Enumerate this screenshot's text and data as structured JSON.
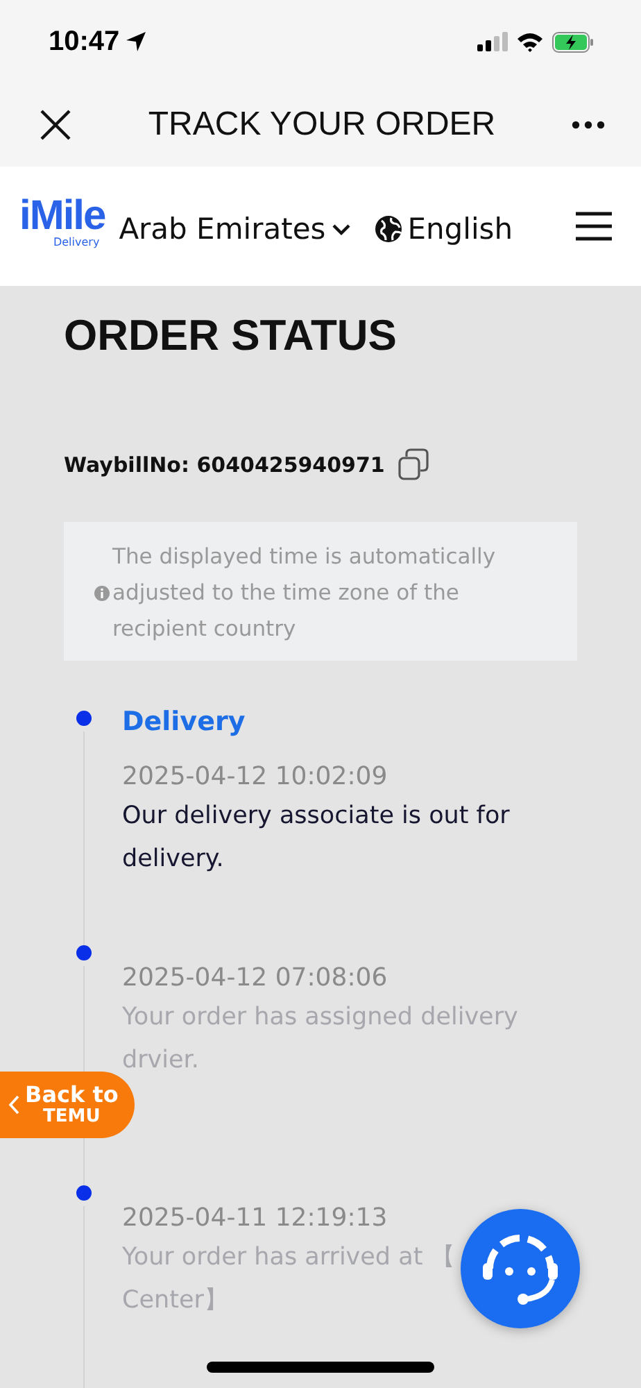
{
  "status_bar": {
    "time": "10:47"
  },
  "nav_bar": {
    "title": "TRACK YOUR ORDER"
  },
  "header": {
    "logo": {
      "name": "iMile",
      "tagline": "Delivery"
    },
    "country": "Arab Emirates",
    "language": "English"
  },
  "page": {
    "title": "ORDER STATUS",
    "waybill": "WaybillNo: 6040425940971",
    "notice": "The displayed time is automatically adjusted to the time zone of the recipient country"
  },
  "events": [
    {
      "title": "Delivery",
      "time": "2025-04-12 10:02:09",
      "lines": [
        "Our delivery associate is out for delivery."
      ],
      "current": true
    },
    {
      "time": "2025-04-12 07:08:06",
      "lines": [
        "Your order has assigned delivery drvier."
      ],
      "current": false
    },
    {
      "time": "2025-04-11 12:19:13",
      "lines": [
        "Your order has arrived at 【",
        "Center】"
      ],
      "current": false
    }
  ],
  "back_button": {
    "line1": "Back to",
    "line2": "TEMU"
  }
}
